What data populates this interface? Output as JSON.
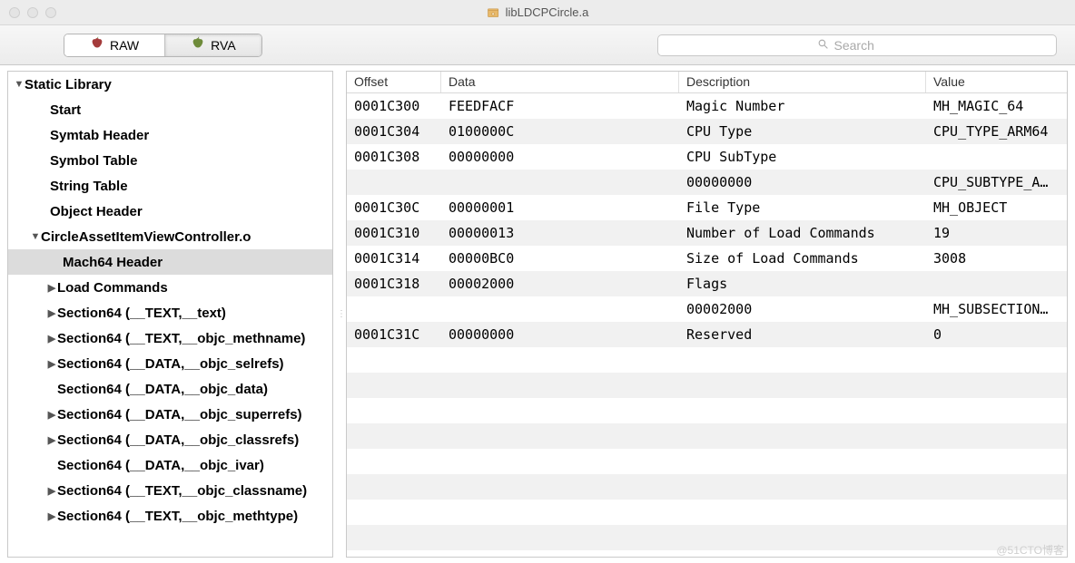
{
  "window": {
    "title": "libLDCPCircle.a"
  },
  "toolbar": {
    "seg_raw": "RAW",
    "seg_rva": "RVA",
    "search_placeholder": "Search"
  },
  "sidebar": {
    "items": [
      {
        "label": "Static Library",
        "depth": 0,
        "disc": "down",
        "pad": "pad0"
      },
      {
        "label": "Start",
        "depth": 1,
        "disc": "",
        "pad": "pad1"
      },
      {
        "label": "Symtab Header",
        "depth": 1,
        "disc": "",
        "pad": "pad1"
      },
      {
        "label": "Symbol Table",
        "depth": 1,
        "disc": "",
        "pad": "pad1"
      },
      {
        "label": "String Table",
        "depth": 1,
        "disc": "",
        "pad": "pad1"
      },
      {
        "label": "Object Header",
        "depth": 1,
        "disc": "",
        "pad": "pad1"
      },
      {
        "label": "CircleAssetItemViewController.o",
        "depth": 1,
        "disc": "down",
        "pad": "pad2"
      },
      {
        "label": "Mach64 Header",
        "depth": 2,
        "disc": "",
        "pad": "pad3",
        "selected": true
      },
      {
        "label": "Load Commands",
        "depth": 2,
        "disc": "right",
        "pad": "pad4"
      },
      {
        "label": "Section64 (__TEXT,__text)",
        "depth": 2,
        "disc": "right",
        "pad": "pad4"
      },
      {
        "label": "Section64 (__TEXT,__objc_methname)",
        "depth": 2,
        "disc": "right",
        "pad": "pad4"
      },
      {
        "label": "Section64 (__DATA,__objc_selrefs)",
        "depth": 2,
        "disc": "right",
        "pad": "pad4"
      },
      {
        "label": "Section64 (__DATA,__objc_data)",
        "depth": 2,
        "disc": "",
        "pad": "pad4"
      },
      {
        "label": "Section64 (__DATA,__objc_superrefs)",
        "depth": 2,
        "disc": "right",
        "pad": "pad4"
      },
      {
        "label": "Section64 (__DATA,__objc_classrefs)",
        "depth": 2,
        "disc": "right",
        "pad": "pad4"
      },
      {
        "label": "Section64 (__DATA,__objc_ivar)",
        "depth": 2,
        "disc": "",
        "pad": "pad4"
      },
      {
        "label": "Section64 (__TEXT,__objc_classname)",
        "depth": 2,
        "disc": "right",
        "pad": "pad4"
      },
      {
        "label": "Section64 (__TEXT,__objc_methtype)",
        "depth": 2,
        "disc": "right",
        "pad": "pad4"
      }
    ]
  },
  "table": {
    "columns": {
      "offset": "Offset",
      "data": "Data",
      "desc": "Description",
      "value": "Value"
    },
    "rows": [
      {
        "offset": "0001C300",
        "data": "FEEDFACF",
        "desc": "Magic Number",
        "value": "MH_MAGIC_64"
      },
      {
        "offset": "0001C304",
        "data": "0100000C",
        "desc": "CPU Type",
        "value": "CPU_TYPE_ARM64"
      },
      {
        "offset": "0001C308",
        "data": "00000000",
        "desc": "CPU SubType",
        "value": ""
      },
      {
        "offset": "",
        "data": "",
        "desc": "00000000",
        "value": "CPU_SUBTYPE_A…"
      },
      {
        "offset": "0001C30C",
        "data": "00000001",
        "desc": "File Type",
        "value": "MH_OBJECT"
      },
      {
        "offset": "0001C310",
        "data": "00000013",
        "desc": "Number of Load Commands",
        "value": "19"
      },
      {
        "offset": "0001C314",
        "data": "00000BC0",
        "desc": "Size of Load Commands",
        "value": "3008"
      },
      {
        "offset": "0001C318",
        "data": "00002000",
        "desc": "Flags",
        "value": ""
      },
      {
        "offset": "",
        "data": "",
        "desc": "00002000",
        "value": "MH_SUBSECTION…"
      },
      {
        "offset": "0001C31C",
        "data": "00000000",
        "desc": "Reserved",
        "value": "0"
      }
    ]
  },
  "watermark": "@51CTO博客"
}
